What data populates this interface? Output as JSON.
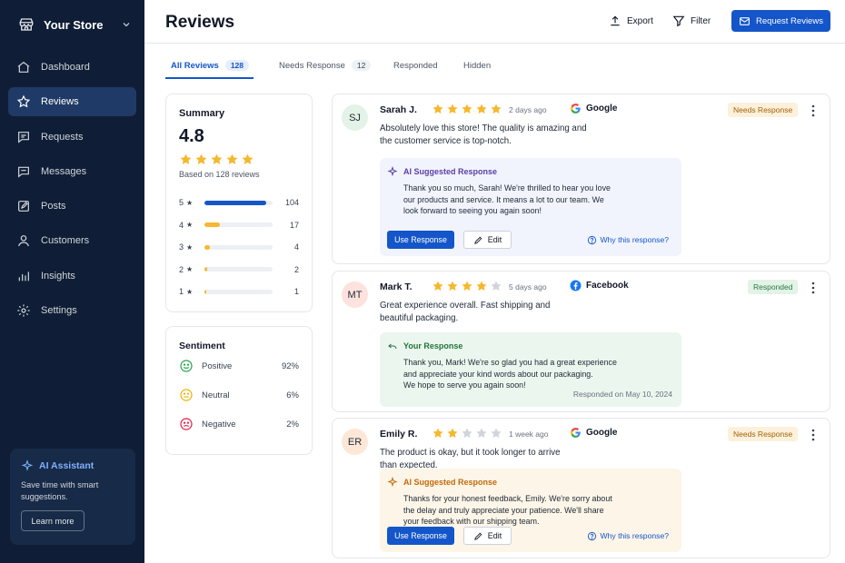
{
  "sidebar": {
    "store_name": "Your Store",
    "items": [
      {
        "label": "Dashboard",
        "icon": "home-icon"
      },
      {
        "label": "Reviews",
        "icon": "star-outline-icon",
        "active": true
      },
      {
        "label": "Requests",
        "icon": "message-square-icon"
      },
      {
        "label": "Messages",
        "icon": "chat-icon"
      },
      {
        "label": "Posts",
        "icon": "edit-square-icon"
      },
      {
        "label": "Customers",
        "icon": "user-icon"
      },
      {
        "label": "Insights",
        "icon": "bar-chart-icon"
      },
      {
        "label": "Settings",
        "icon": "gear-icon"
      }
    ],
    "ai": {
      "title": "AI Assistant",
      "desc_line1": "Save time with smart",
      "desc_line2": "suggestions.",
      "learn": "Learn more"
    }
  },
  "header": {
    "title": "Reviews",
    "export": "Export",
    "filter": "Filter",
    "request": "Request Reviews"
  },
  "tabs": [
    {
      "label": "All Reviews",
      "count": "128",
      "active": true
    },
    {
      "label": "Needs Response",
      "count": "12"
    },
    {
      "label": "Responded",
      "count": ""
    },
    {
      "label": "Hidden",
      "count": ""
    }
  ],
  "summary": {
    "title": "Summary",
    "average": "4.8",
    "based_on": "Based on 128 reviews",
    "distribution": [
      {
        "stars": "5",
        "count": "104",
        "fraction": 0.9,
        "color": "#1456c9"
      },
      {
        "stars": "4",
        "count": "17",
        "fraction": 0.22,
        "color": "#f5b82e"
      },
      {
        "stars": "3",
        "count": "4",
        "fraction": 0.08,
        "color": "#f5b82e"
      },
      {
        "stars": "2",
        "count": "2",
        "fraction": 0.04,
        "color": "#f5b82e"
      },
      {
        "stars": "1",
        "count": "1",
        "fraction": 0.02,
        "color": "#f5b82e"
      }
    ]
  },
  "sentiment": {
    "title": "Sentiment",
    "rows": [
      {
        "label": "Positive",
        "pct": "92%",
        "color": "#22a447"
      },
      {
        "label": "Neutral",
        "pct": "6%",
        "color": "#eab308"
      },
      {
        "label": "Negative",
        "pct": "2%",
        "color": "#e11d48"
      }
    ]
  },
  "reviews": [
    {
      "initials": "SJ",
      "avatar_bg": "#e3f3e7",
      "name": "Sarah J.",
      "rating": 5,
      "time": "2 days ago",
      "source": "Google",
      "status": "Needs Response",
      "text1": "Absolutely love this store! The quality is amazing and",
      "text2": "the customer service is top-notch.",
      "panel_title": "AI Suggested Response",
      "panel1": "Thank you so much, Sarah! We're thrilled to hear you love",
      "panel2": "our products and service. It means a lot to our team. We",
      "panel3": "look forward to seeing you again soon!",
      "use": "Use Response",
      "edit": "Edit",
      "why": "Why this response?"
    },
    {
      "initials": "MT",
      "avatar_bg": "#fde2dd",
      "name": "Mark T.",
      "rating": 4,
      "time": "5 days ago",
      "source": "Facebook",
      "status": "Responded",
      "text1": "Great experience overall. Fast shipping and",
      "text2": "beautiful packaging.",
      "panel_title": "Your Response",
      "panel1": "Thank you, Mark! We're so glad you had a great experience",
      "panel2": "and appreciate your kind words about our packaging.",
      "panel3": "We hope to serve you again soon!",
      "responded_on": "Responded on May 10, 2024"
    },
    {
      "initials": "ER",
      "avatar_bg": "#fde7d6",
      "name": "Emily R.",
      "rating": 2,
      "time": "1 week ago",
      "source": "Google",
      "status": "Needs Response",
      "text1": "The product is okay, but it took longer to arrive",
      "text2": "than expected.",
      "panel_title": "AI Suggested Response",
      "panel1": "Thanks for your honest feedback, Emily. We're sorry about",
      "panel2": "the delay and truly appreciate your patience. We'll share",
      "panel3": "your feedback with our shipping team.",
      "use": "Use Response",
      "edit": "Edit",
      "why": "Why this response?"
    }
  ],
  "colors": {
    "accent": "#1456c9",
    "star": "#f5b82e",
    "sidebar": "#0f1e36"
  }
}
